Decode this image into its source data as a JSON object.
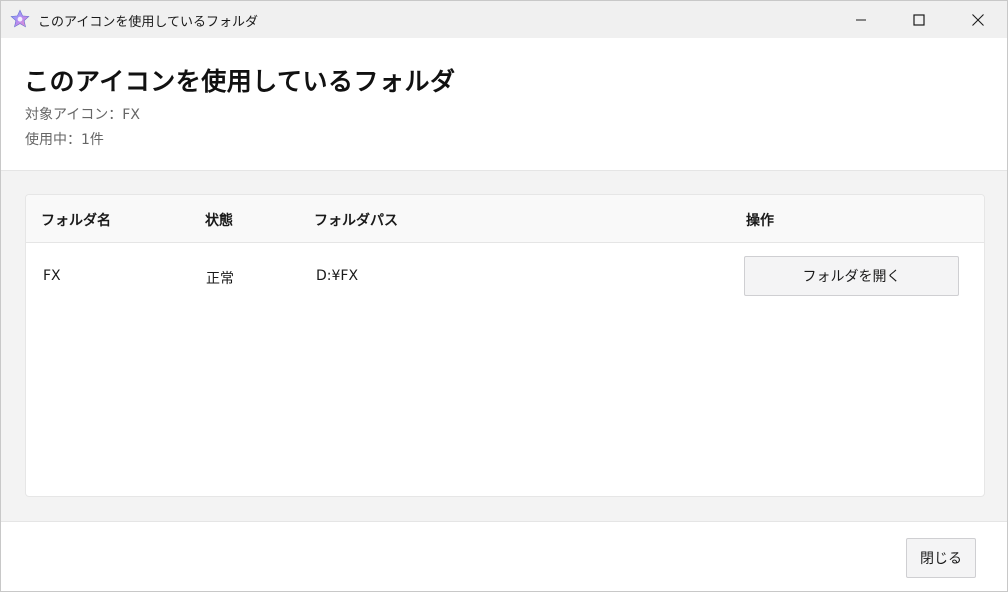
{
  "window": {
    "title": "このアイコンを使用しているフォルダ",
    "app_icon": "star-icon"
  },
  "header": {
    "title": "このアイコンを使用しているフォルダ",
    "target_icon": "対象アイコン：FX",
    "usage_count": "使用中：1件"
  },
  "table": {
    "columns": [
      "フォルダ名",
      "状態",
      "フォルダパス",
      "操作"
    ],
    "rows": [
      {
        "name": "FX",
        "status": "正常",
        "path": "D:¥FX",
        "action_label": "フォルダを開く"
      }
    ]
  },
  "footer": {
    "close_label": "閉じる"
  },
  "colors": {
    "accent_star": "#5b8def",
    "header_bg": "#ffffff",
    "body_bg": "#f3f3f3"
  }
}
